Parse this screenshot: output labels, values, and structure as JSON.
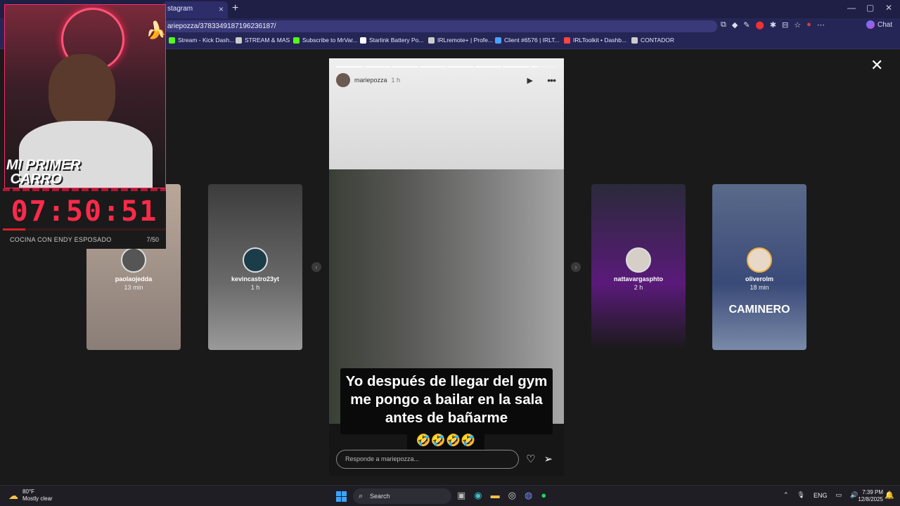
{
  "browser": {
    "tab_title": "stagram",
    "url": "ariepozza/3783349187196236187/",
    "chat_label": "Chat",
    "bookmarks": [
      {
        "label": "Stream - Kick Dash...",
        "icon_color": "#53fc18"
      },
      {
        "label": "STREAM & MAS",
        "icon_color": "#cccccc"
      },
      {
        "label": "Subscribe to MrVar...",
        "icon_color": "#53fc18"
      },
      {
        "label": "Starlink Battery Po...",
        "icon_color": "#ffffff"
      },
      {
        "label": "IRLremote+ | Profe...",
        "icon_color": "#cccccc"
      },
      {
        "label": "Client #6576 | IRLT...",
        "icon_color": "#4aa3ff"
      },
      {
        "label": "IRLToolkit • Dashb...",
        "icon_color": "#ff4444"
      },
      {
        "label": "CONTADOR",
        "icon_color": "#cccccc"
      }
    ]
  },
  "stories": {
    "previews": [
      {
        "username": "paolaojedda",
        "time": "13 min"
      },
      {
        "username": "kevincastro23yt",
        "time": "1 h"
      },
      {
        "username": "nattavargasphto",
        "time": "2 h"
      },
      {
        "username": "oliverolm",
        "time": "18 min"
      }
    ],
    "poster_text": "CAMINERO",
    "main": {
      "username": "mariepozza",
      "time": "1 h",
      "caption": "Yo después de llegar del gym me pongo a bailar en la sala antes de bañarme",
      "emojis": "🤣🤣🤣🤣",
      "reply_placeholder": "Responde a mariepozza...",
      "segments": 8,
      "current_segment_progress": 0.3
    }
  },
  "overlay": {
    "title": "MI PRIMER\n CARRO",
    "timer": "07:50:51",
    "goal_label": "COCINA CON ENDY ESPOSADO",
    "goal_count": "7/50",
    "goal_progress": 0.14,
    "brand_color": "#ff2a4a"
  },
  "taskbar": {
    "temperature": "80°F",
    "weather": "Mostly clear",
    "search_label": "Search",
    "lang": "ENG",
    "time": "7:39 PM",
    "date": "12/8/2025"
  }
}
